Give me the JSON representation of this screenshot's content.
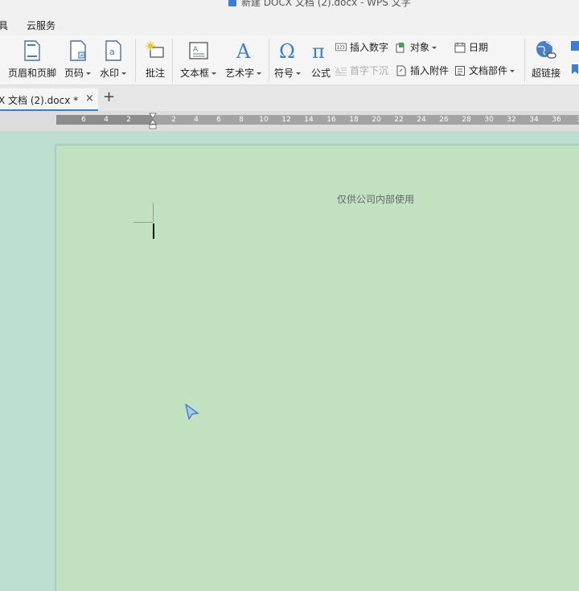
{
  "window": {
    "title": "新建 DOCX 文档 (2).docx  - WPS 文字"
  },
  "menubar": {
    "items": [
      "具",
      "云服务"
    ]
  },
  "ribbon": {
    "header_footer": "页眉和页脚",
    "page_number": "页码",
    "watermark": "水印",
    "comment": "批注",
    "textbox": "文本框",
    "wordart": "艺术字",
    "symbol": "符号",
    "formula": "公式",
    "insert_number": "插入数字",
    "object": "对象",
    "date": "日期",
    "drop_cap": "首字下沉",
    "attachment": "插入附件",
    "doc_parts": "文档部件",
    "hyperlink": "超链接"
  },
  "tabs": {
    "doc_tab": "X 文档 (2).docx *",
    "close": "×",
    "new": "+"
  },
  "ruler": {
    "numbers": [
      "6",
      "4",
      "2",
      "2",
      "4",
      "6",
      "8",
      "10",
      "12",
      "14",
      "16",
      "18",
      "20",
      "22",
      "24",
      "26",
      "28",
      "30",
      "32",
      "34",
      "36",
      "3"
    ]
  },
  "document": {
    "header_text": "仅供公司内部使用"
  },
  "colors": {
    "accent": "#3d7bd8",
    "page_bg": "#c2e1c1",
    "doc_bg": "#bcdfd0"
  }
}
